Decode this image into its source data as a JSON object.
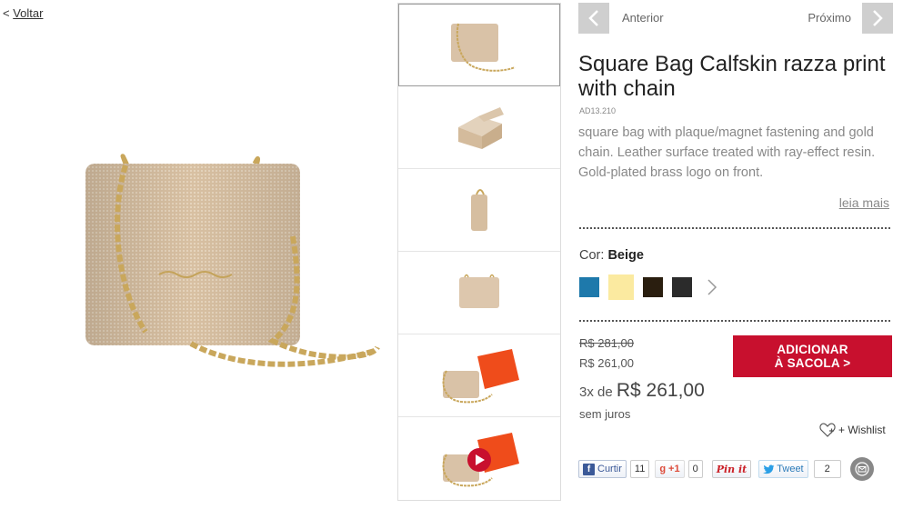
{
  "back_link": {
    "prefix": "<",
    "label": "Voltar"
  },
  "nav": {
    "prev_label": "Anterior",
    "next_label": "Próximo"
  },
  "product": {
    "title": "Square Bag Calfskin razza print with chain",
    "sku": "AD13.210",
    "description": "square bag with plaque/magnet fastening and gold chain. Leather surface treated with ray-effect resin. Gold-plated brass logo on front.",
    "read_more": "leia mais"
  },
  "color": {
    "label": "Cor:",
    "selected": "Beige",
    "swatches": [
      {
        "name": "blue",
        "hex": "#1e79ab"
      },
      {
        "name": "beige",
        "hex": "#fbeaa0",
        "selected": true
      },
      {
        "name": "dark-brown",
        "hex": "#2a1e0f"
      },
      {
        "name": "black",
        "hex": "#2b2b2b"
      }
    ]
  },
  "pricing": {
    "old_price": "R$ 281,00",
    "price": "R$ 261,00",
    "installments_prefix": "3x de",
    "installment_value": "R$ 261,00",
    "interest_note": "sem juros"
  },
  "add_to_bag": {
    "line1": "ADICIONAR",
    "line2": "À SACOLA >"
  },
  "wishlist": {
    "label": "+ Wishlist"
  },
  "social": {
    "facebook": {
      "label": "Curtir",
      "count": "11"
    },
    "gplus": {
      "label": "+1",
      "count": "0"
    },
    "pinterest": {
      "label": "Pin it"
    },
    "twitter": {
      "label": "Tweet",
      "count": "2"
    }
  },
  "colors": {
    "accent_red": "#c8102e",
    "nav_button": "#cfcfcf",
    "bag_leather": "#d9c2a7",
    "chain_gold": "#c9a75c"
  },
  "thumbnails": [
    "bag-front",
    "bag-open",
    "bag-side",
    "bag-small-front",
    "bag-with-box",
    "bag-video"
  ]
}
